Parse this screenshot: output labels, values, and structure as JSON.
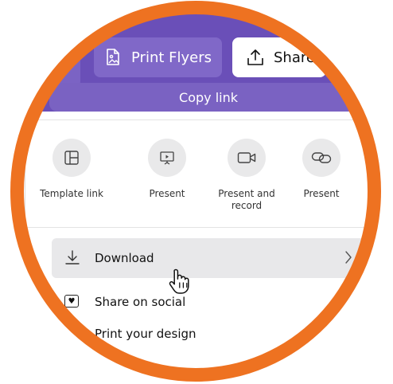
{
  "toolbar": {
    "print_label": "Print Flyers",
    "share_label": "Share"
  },
  "copy_link": {
    "label": "Copy link"
  },
  "share_options": [
    {
      "label": "Template link",
      "icon": "template-icon"
    },
    {
      "label": "Present",
      "icon": "present-icon"
    },
    {
      "label": "Present and record",
      "icon": "camera-icon"
    },
    {
      "label": "Present",
      "icon": "link-icon"
    }
  ],
  "menu": {
    "download_label": "Download",
    "share_social_label": "Share on social",
    "print_design_label": "Print your design"
  },
  "colors": {
    "ring": "#ee7221",
    "brand_purple": "#6a4fb8"
  }
}
